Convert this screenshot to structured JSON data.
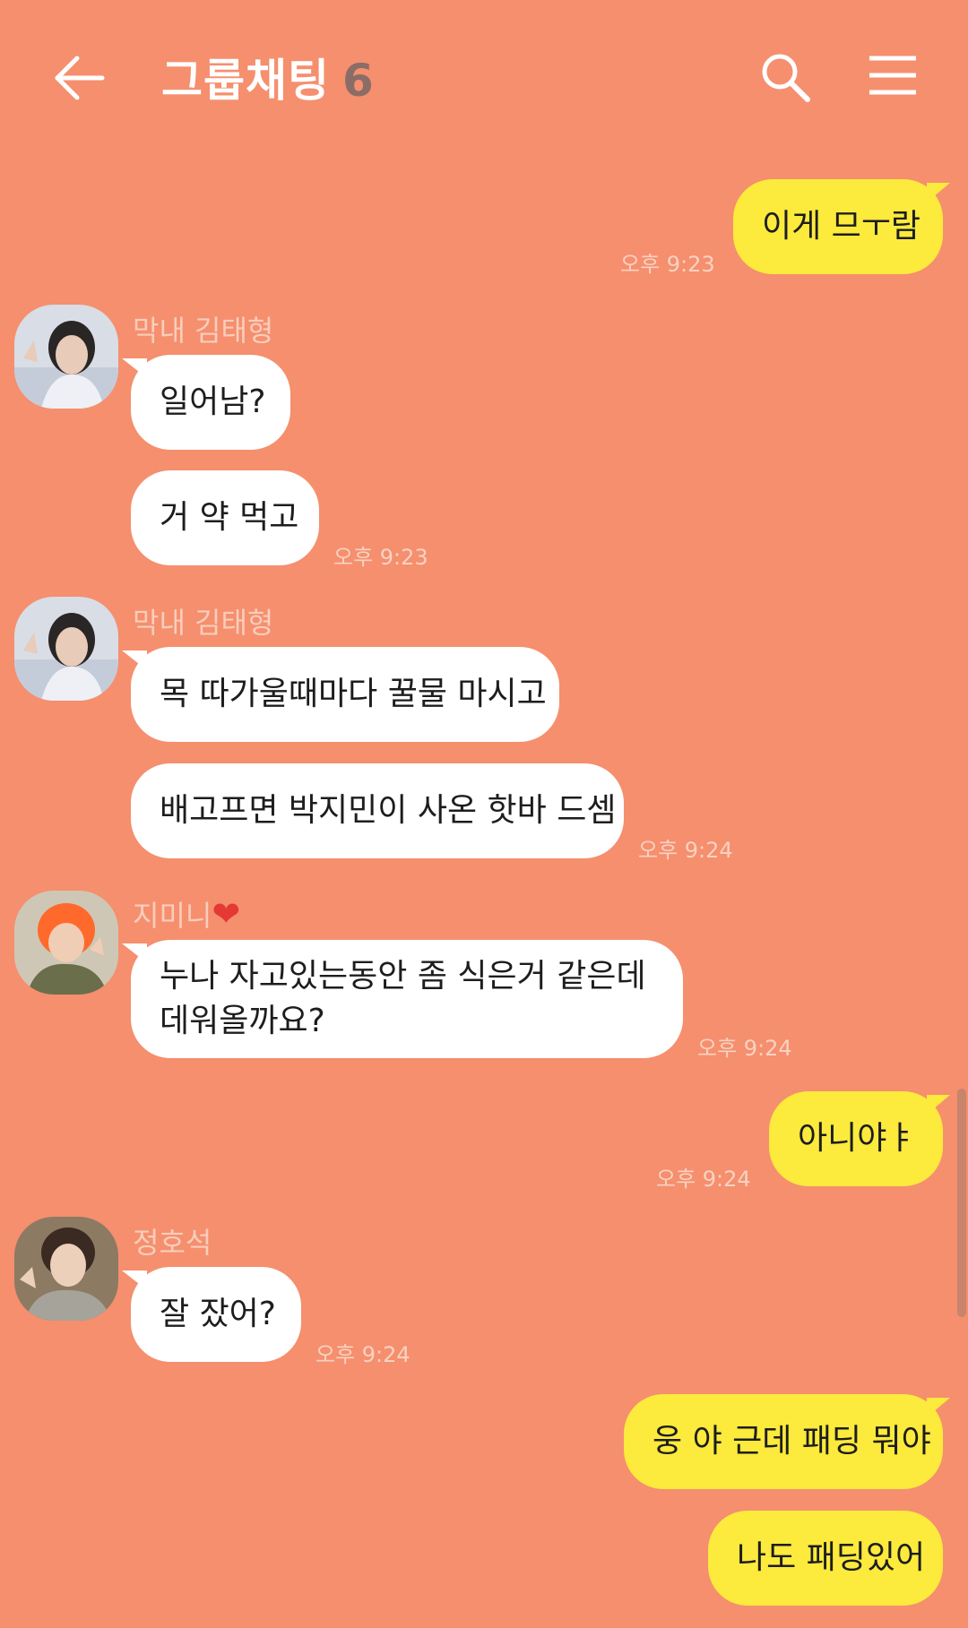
{
  "header": {
    "title": "그룹채팅",
    "member_count": "6"
  },
  "messages": [
    {
      "id": "m1",
      "side": "right",
      "text": "이게 므ㅜ람",
      "time": "오후 9:23"
    },
    {
      "id": "m2",
      "side": "left",
      "sender": "막내 김태형",
      "text": "일어남?"
    },
    {
      "id": "m3",
      "side": "left",
      "text": "거 약 먹고",
      "time": "오후 9:23"
    },
    {
      "id": "m4",
      "side": "left",
      "sender": "막내 김태형",
      "text": "목 따가울때마다 꿀물 마시고"
    },
    {
      "id": "m5",
      "side": "left",
      "text": "배고프면 박지민이 사온 핫바 드셈",
      "time": "오후 9:24"
    },
    {
      "id": "m6",
      "side": "left",
      "sender": "지미니",
      "sender_emoji": "❤",
      "text_line1": "누나 자고있는동안 좀 식은거 같은데",
      "text_line2": "데워올까요?",
      "time": "오후 9:24"
    },
    {
      "id": "m7",
      "side": "right",
      "text": "아니야ㅑ",
      "time": "오후 9:24"
    },
    {
      "id": "m8",
      "side": "left",
      "sender": "정호석",
      "text": "잘 잤어?",
      "time": "오후 9:24"
    },
    {
      "id": "m9",
      "side": "right",
      "text": "웅 야 근데 패딩 뭐야"
    },
    {
      "id": "m10",
      "side": "right",
      "text": "나도 패딩있어"
    }
  ],
  "icons": {
    "back": "arrow-left-icon",
    "search": "search-icon",
    "menu": "hamburger-menu-icon"
  },
  "colors": {
    "background": "#f58f6e",
    "my_bubble": "#fcea3c",
    "other_bubble": "#ffffff",
    "time_text": "#f9d2c2"
  }
}
